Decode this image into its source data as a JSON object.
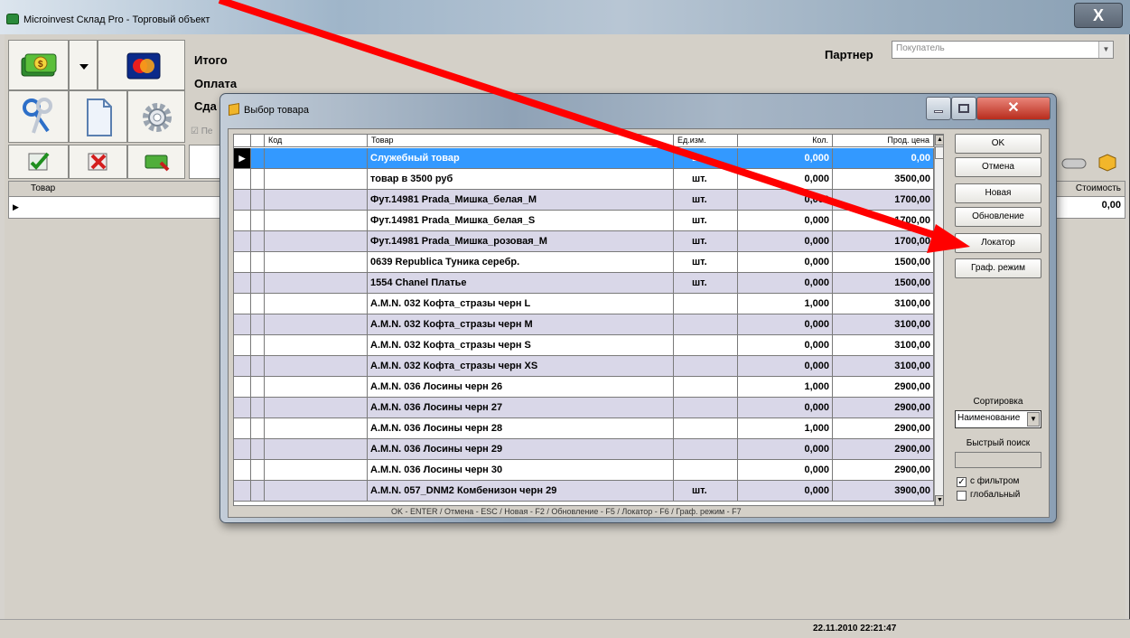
{
  "app": {
    "title": "Microinvest Склад Pro - Торговый объект",
    "close_glyph": "X"
  },
  "summary": {
    "total_label": "Итого",
    "payment_label": "Оплата",
    "change_label": "Сда",
    "partial_check": "☑ Пе"
  },
  "partner": {
    "label": "Партнер",
    "value": "Покупатель"
  },
  "main_grid": {
    "col_item": "Товар",
    "col_cost": "Стоимость",
    "cost_value": "0,00"
  },
  "status": {
    "datetime": "22.11.2010 22:21:47"
  },
  "dialog": {
    "title": "Выбор товара",
    "columns": [
      "Код",
      "Товар",
      "Ед.изм.",
      "Кол.",
      "Прод. цена"
    ],
    "rows": [
      {
        "code": "",
        "name": "Служебный товар",
        "unit": "шт.",
        "qty": "0,000",
        "price": "0,00"
      },
      {
        "code": "",
        "name": "товар в 3500 руб",
        "unit": "шт.",
        "qty": "0,000",
        "price": "3500,00"
      },
      {
        "code": "",
        "name": "Фут.14981 Prada_Мишка_белая_М",
        "unit": "шт.",
        "qty": "0,000",
        "price": "1700,00"
      },
      {
        "code": "",
        "name": "Фут.14981 Prada_Мишка_белая_S",
        "unit": "шт.",
        "qty": "0,000",
        "price": "1700,00"
      },
      {
        "code": "",
        "name": "Фут.14981 Prada_Мишка_розовая_М",
        "unit": "шт.",
        "qty": "0,000",
        "price": "1700,00"
      },
      {
        "code": "",
        "name": "0639 Republica Туника серебр.",
        "unit": "шт.",
        "qty": "0,000",
        "price": "1500,00"
      },
      {
        "code": "",
        "name": "1554 Chanel Платье",
        "unit": "шт.",
        "qty": "0,000",
        "price": "1500,00"
      },
      {
        "code": "",
        "name": "A.M.N. 032 Кофта_стразы черн L",
        "unit": "",
        "qty": "1,000",
        "price": "3100,00"
      },
      {
        "code": "",
        "name": "A.M.N. 032 Кофта_стразы черн M",
        "unit": "",
        "qty": "0,000",
        "price": "3100,00"
      },
      {
        "code": "",
        "name": "A.M.N. 032 Кофта_стразы черн S",
        "unit": "",
        "qty": "0,000",
        "price": "3100,00"
      },
      {
        "code": "",
        "name": "A.M.N. 032 Кофта_стразы черн XS",
        "unit": "",
        "qty": "0,000",
        "price": "3100,00"
      },
      {
        "code": "",
        "name": "A.M.N. 036 Лосины черн 26",
        "unit": "",
        "qty": "1,000",
        "price": "2900,00"
      },
      {
        "code": "",
        "name": "A.M.N. 036 Лосины черн 27",
        "unit": "",
        "qty": "0,000",
        "price": "2900,00"
      },
      {
        "code": "",
        "name": "A.M.N. 036 Лосины черн 28",
        "unit": "",
        "qty": "1,000",
        "price": "2900,00"
      },
      {
        "code": "",
        "name": "A.M.N. 036 Лосины черн 29",
        "unit": "",
        "qty": "0,000",
        "price": "2900,00"
      },
      {
        "code": "",
        "name": "A.M.N. 036 Лосины черн 30",
        "unit": "",
        "qty": "0,000",
        "price": "2900,00"
      },
      {
        "code": "",
        "name": "A.M.N. 057_DNM2 Комбенизон черн 29",
        "unit": "шт.",
        "qty": "0,000",
        "price": "3900,00"
      }
    ],
    "shortcuts": "OK - ENTER / Отмена - ESC / Новая - F2 / Обновление - F5 / Локатор - F6 / Граф. режим - F7",
    "buttons": {
      "ok": "OK",
      "cancel": "Отмена",
      "new": "Новая",
      "refresh": "Обновление",
      "locator": "Локатор",
      "graph_mode": "Граф. режим"
    },
    "sort_label": "Сортировка",
    "sort_value": "Наименование",
    "quick_search_label": "Быстрый поиск",
    "quick_search_value": "",
    "filter_label": "с фильтром",
    "filter_checked": true,
    "global_label": "глобальный",
    "global_checked": false
  },
  "colors": {
    "selected_row": "#3399ff",
    "stripe_row": "#d9d7e8",
    "arrow": "#ff0000"
  }
}
